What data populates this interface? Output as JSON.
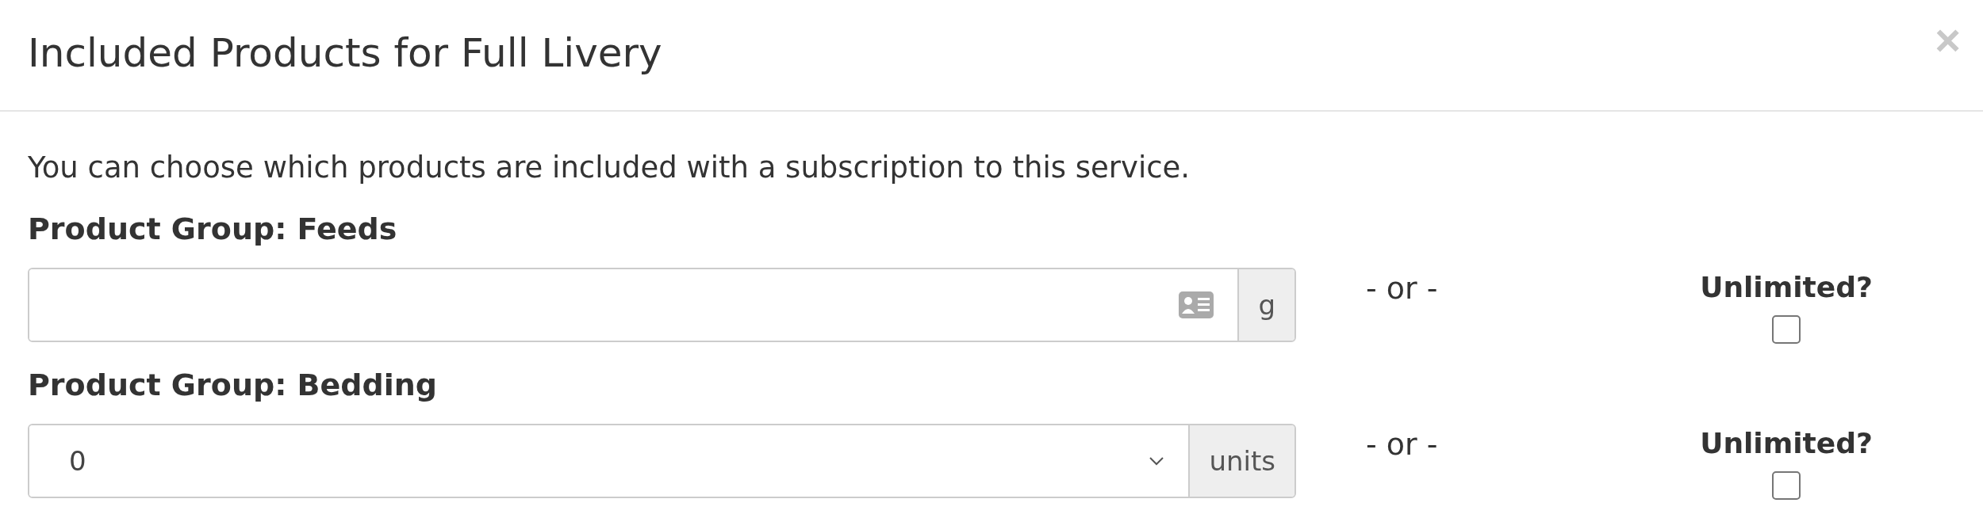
{
  "dialog": {
    "title": "Included Products for Full Livery",
    "close": "×"
  },
  "intro": "You can choose which products are included with a subscription to this service.",
  "groups": [
    {
      "label": "Product Group: Feeds",
      "kind": "text",
      "unit": "g",
      "separator": "- or -",
      "unlimited_label": "Unlimited?",
      "unlimited": false
    },
    {
      "label": "Product Group: Bedding",
      "kind": "select",
      "value": "0",
      "unit": "units",
      "separator": "- or -",
      "unlimited_label": "Unlimited?",
      "unlimited": false
    }
  ]
}
